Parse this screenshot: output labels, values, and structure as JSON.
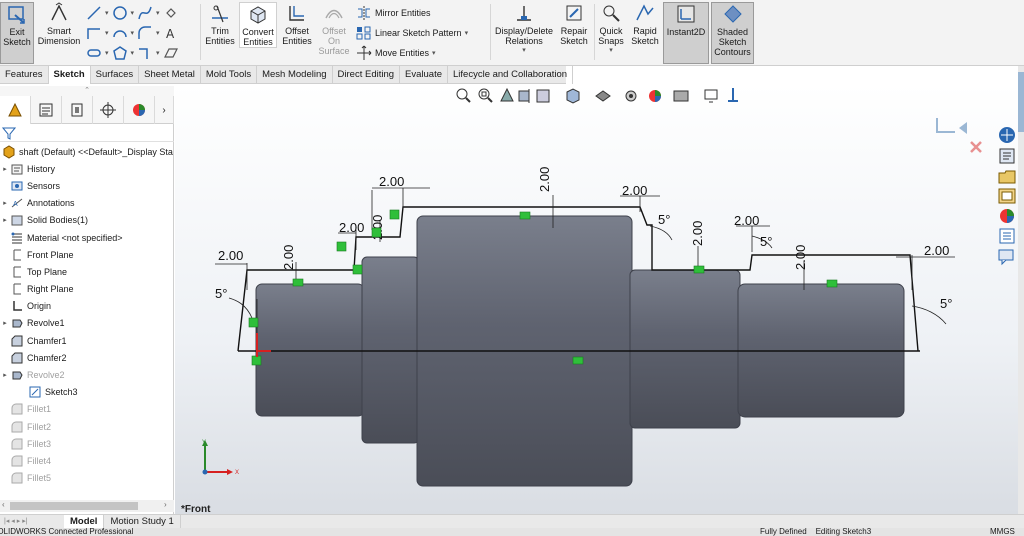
{
  "ribbon": {
    "exit_sketch": "Exit\nSketch",
    "smart_dimension": "Smart\nDimension",
    "trim_entities": "Trim\nEntities",
    "convert_entities": "Convert\nEntities",
    "offset_entities": "Offset\nEntities",
    "offset_on_surface": "Offset\nOn\nSurface",
    "mirror_entities": "Mirror Entities",
    "linear_sketch_pattern": "Linear Sketch Pattern",
    "move_entities": "Move Entities",
    "display_delete_relations": "Display/Delete\nRelations",
    "repair_sketch": "Repair\nSketch",
    "quick_snaps": "Quick\nSnaps",
    "rapid_sketch": "Rapid\nSketch",
    "instant2d": "Instant2D",
    "shaded_sketch_contours": "Shaded\nSketch\nContours"
  },
  "tabs": [
    "Features",
    "Sketch",
    "Surfaces",
    "Sheet Metal",
    "Mold Tools",
    "Mesh Modeling",
    "Direct Editing",
    "Evaluate",
    "Lifecycle and Collaboration"
  ],
  "active_tab": "Sketch",
  "tree": {
    "root": "shaft (Default) <<Default>_Display Sta",
    "items": [
      {
        "label": "History",
        "icon": "history-icon",
        "expander": true,
        "dim": false,
        "indent": 0
      },
      {
        "label": "Sensors",
        "icon": "sensors-icon",
        "expander": false,
        "dim": false,
        "indent": 0
      },
      {
        "label": "Annotations",
        "icon": "annotations-icon",
        "expander": true,
        "dim": false,
        "indent": 0
      },
      {
        "label": "Solid Bodies(1)",
        "icon": "solid-bodies-icon",
        "expander": true,
        "dim": false,
        "indent": 0
      },
      {
        "label": "Material <not specified>",
        "icon": "material-icon",
        "expander": false,
        "dim": false,
        "indent": 0
      },
      {
        "label": "Front Plane",
        "icon": "plane-icon",
        "expander": false,
        "dim": false,
        "indent": 0
      },
      {
        "label": "Top Plane",
        "icon": "plane-icon",
        "expander": false,
        "dim": false,
        "indent": 0
      },
      {
        "label": "Right Plane",
        "icon": "plane-icon",
        "expander": false,
        "dim": false,
        "indent": 0
      },
      {
        "label": "Origin",
        "icon": "origin-icon",
        "expander": false,
        "dim": false,
        "indent": 0
      },
      {
        "label": "Revolve1",
        "icon": "revolve-icon",
        "expander": true,
        "dim": false,
        "indent": 0
      },
      {
        "label": "Chamfer1",
        "icon": "chamfer-icon",
        "expander": false,
        "dim": false,
        "indent": 0
      },
      {
        "label": "Chamfer2",
        "icon": "chamfer-icon",
        "expander": false,
        "dim": false,
        "indent": 0
      },
      {
        "label": "Revolve2",
        "icon": "revolve-icon",
        "expander": true,
        "dim": true,
        "indent": 0
      },
      {
        "label": "Sketch3",
        "icon": "sketch-icon",
        "expander": false,
        "dim": false,
        "indent": 1
      },
      {
        "label": "Fillet1",
        "icon": "fillet-icon",
        "expander": false,
        "dim": true,
        "indent": 0
      },
      {
        "label": "Fillet2",
        "icon": "fillet-icon",
        "expander": false,
        "dim": true,
        "indent": 0
      },
      {
        "label": "Fillet3",
        "icon": "fillet-icon",
        "expander": false,
        "dim": true,
        "indent": 0
      },
      {
        "label": "Fillet4",
        "icon": "fillet-icon",
        "expander": false,
        "dim": true,
        "indent": 0
      },
      {
        "label": "Fillet5",
        "icon": "fillet-icon",
        "expander": false,
        "dim": true,
        "indent": 0
      }
    ]
  },
  "bottom_tabs": [
    "Model",
    "Motion Study 1"
  ],
  "active_bottom_tab": "Model",
  "status": {
    "left": "SOLIDWORKS Connected Professional",
    "middle": "Fully Defined    Editing Sketch3",
    "right": "MMGS"
  },
  "viewport": {
    "view_label": "*Front",
    "axis_x": "X",
    "axis_y": "Y",
    "dim_top_left": "2.00",
    "dim_step2_h": "2.00",
    "dim_step2_v": "2.00",
    "dim_step3_h": "2.00",
    "dim_center_v": "2.00",
    "dim_right1_h": "2.00",
    "dim_right2_h": "2.00",
    "dim_right2_v": "2.00",
    "dim_right3_v": "2.00",
    "dim_far_right_h": "2.00",
    "dim_left_v": "2.00",
    "angle_left": "5°",
    "angle_right1": "5°",
    "angle_right2": "5°",
    "angle_far_right": "5°"
  },
  "colors": {
    "body_fill": "#5f6370",
    "body_edge": "#3e414b",
    "sketch_line": "#111111",
    "relation_green": "#2fbf3a",
    "origin_red": "#d62020",
    "ribbon_bg": "#f3f3f3"
  }
}
